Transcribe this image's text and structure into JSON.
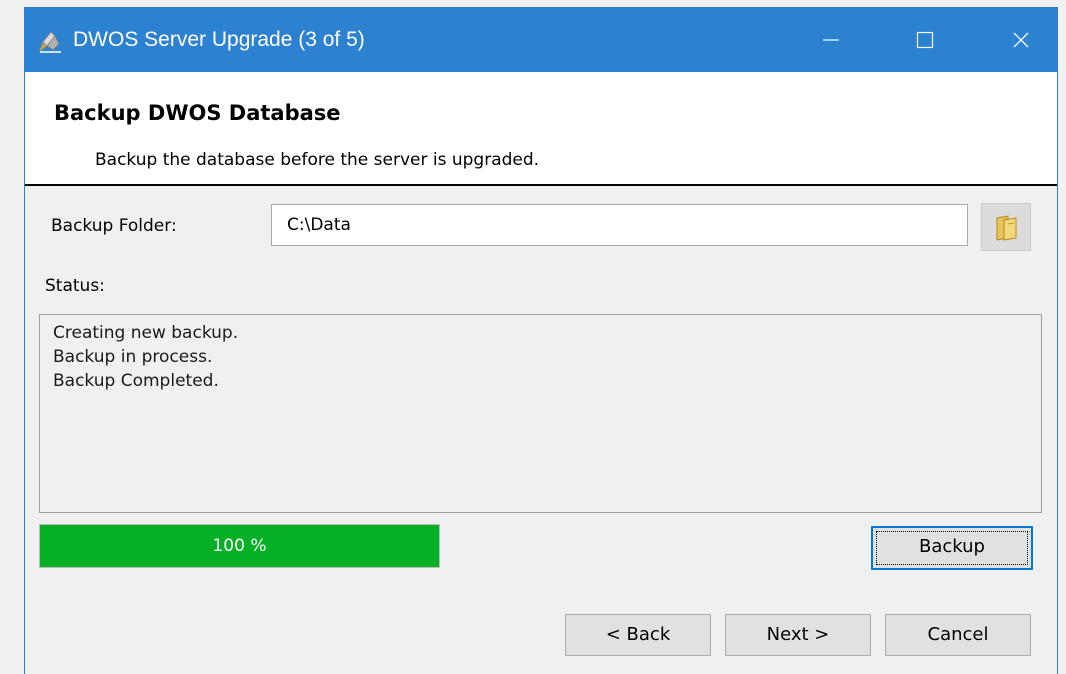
{
  "window": {
    "title": "DWOS Server Upgrade (3 of 5)",
    "accent_color": "#2c81d0",
    "app_icon": "dwos-app-icon",
    "controls": [
      "minimize-icon",
      "maximize-icon",
      "close-icon"
    ]
  },
  "header": {
    "title": "Backup DWOS Database",
    "subtitle": "Backup the database before the server is upgraded."
  },
  "form": {
    "folder_label": "Backup Folder:",
    "folder_value": "C:\\Data",
    "browse_icon": "folder-icon"
  },
  "status": {
    "label": "Status:",
    "lines": [
      "Creating new backup.",
      "Backup in process.",
      "Backup Completed."
    ]
  },
  "progress": {
    "percent": 100,
    "text": "100 %",
    "fill_color": "#06b025"
  },
  "buttons": {
    "backup": "Backup",
    "back": "< Back",
    "next": "Next >",
    "cancel": "Cancel"
  }
}
